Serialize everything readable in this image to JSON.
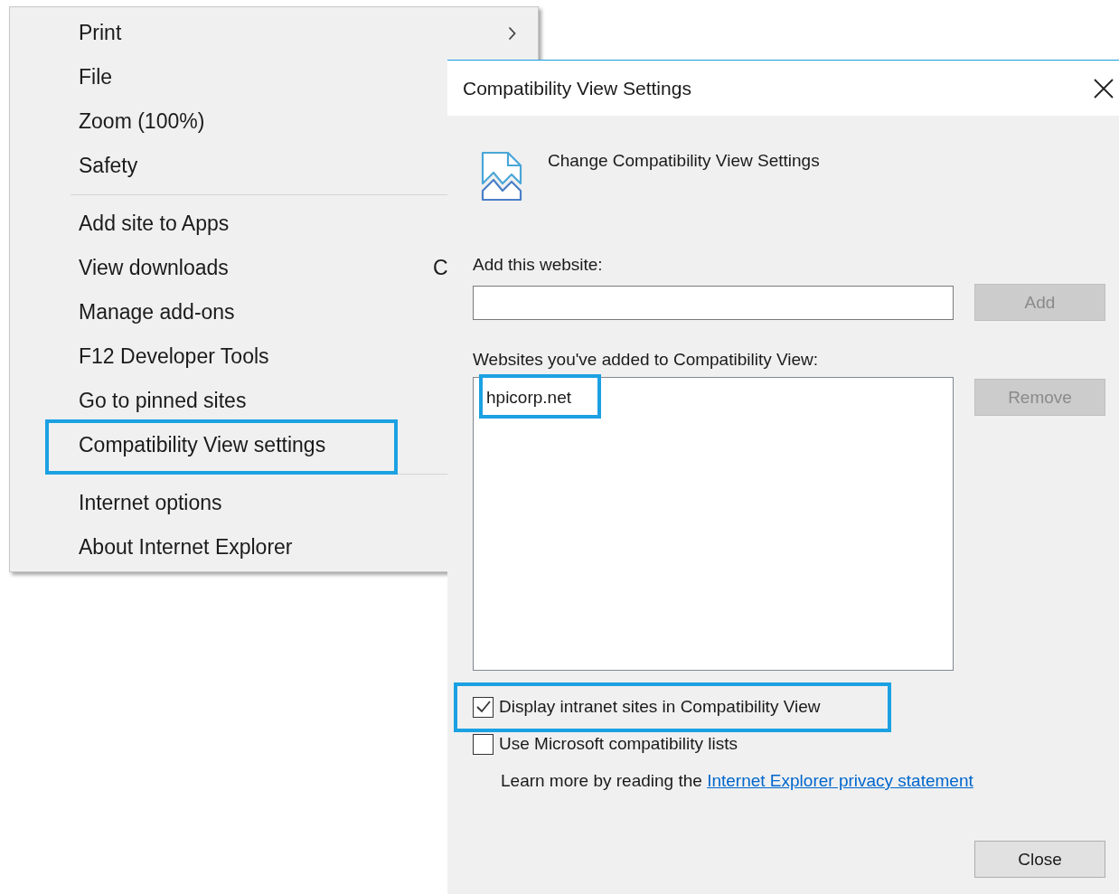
{
  "menu": {
    "sections": [
      {
        "items": [
          {
            "label": "Print",
            "submenu": true,
            "highlighted": false
          },
          {
            "label": "File",
            "submenu": false,
            "highlighted": false
          },
          {
            "label": "Zoom (100%)",
            "submenu": false,
            "highlighted": false
          },
          {
            "label": "Safety",
            "submenu": false,
            "highlighted": false
          }
        ]
      },
      {
        "items": [
          {
            "label": "Add site to Apps",
            "submenu": false,
            "highlighted": false
          },
          {
            "label": "View downloads",
            "shortcut": "C",
            "submenu": false,
            "highlighted": false
          },
          {
            "label": "Manage add-ons",
            "submenu": false,
            "highlighted": false
          },
          {
            "label": "F12 Developer Tools",
            "submenu": false,
            "highlighted": false
          },
          {
            "label": "Go to pinned sites",
            "submenu": false,
            "highlighted": false
          },
          {
            "label": "Compatibility View settings",
            "submenu": false,
            "highlighted": true
          }
        ]
      },
      {
        "items": [
          {
            "label": "Internet options",
            "submenu": false,
            "highlighted": false
          },
          {
            "label": "About Internet Explorer",
            "submenu": false,
            "highlighted": false
          }
        ]
      }
    ]
  },
  "dialog": {
    "title": "Compatibility View Settings",
    "heading": "Change Compatibility View Settings",
    "add_label": "Add this website:",
    "add_button": {
      "label": "Add",
      "disabled": true
    },
    "list_label": "Websites you've added to Compatibility View:",
    "sites": [
      {
        "label": "hpicorp.net",
        "highlighted": true
      }
    ],
    "remove_button": {
      "label": "Remove",
      "disabled": true
    },
    "options": [
      {
        "label": "Display intranet sites in Compatibility View",
        "checked": true,
        "highlighted": true
      },
      {
        "label": "Use Microsoft compatibility lists",
        "checked": false,
        "highlighted": false
      }
    ],
    "learn_more": {
      "text": "Learn more by reading the ",
      "link": "Internet Explorer privacy statement"
    },
    "close_button": {
      "label": "Close",
      "disabled": false
    }
  }
}
